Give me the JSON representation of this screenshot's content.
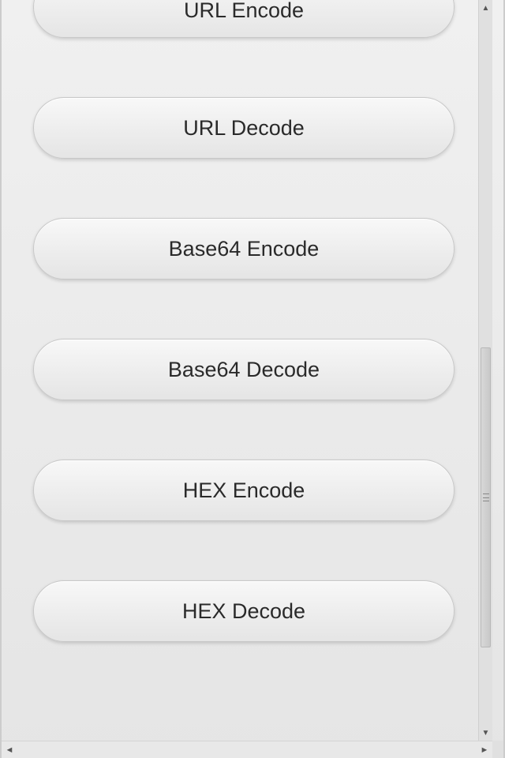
{
  "buttons": [
    {
      "label": "URL Encode"
    },
    {
      "label": "URL Decode"
    },
    {
      "label": "Base64 Encode"
    },
    {
      "label": "Base64 Decode"
    },
    {
      "label": "HEX Encode"
    },
    {
      "label": "HEX Decode"
    }
  ]
}
